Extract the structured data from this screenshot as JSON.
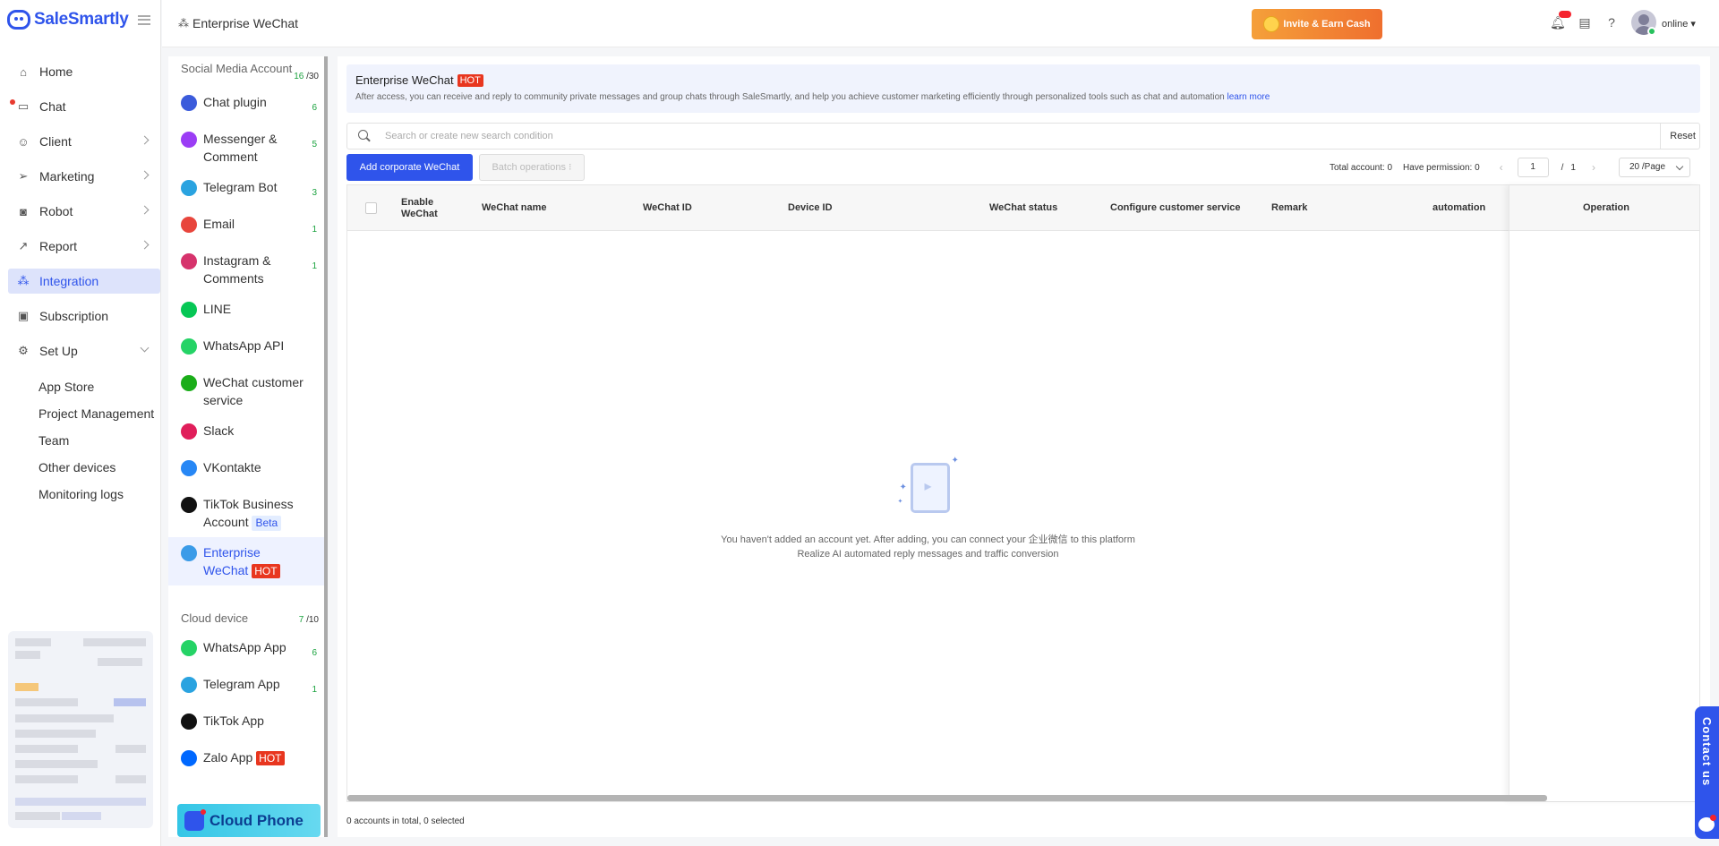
{
  "brand": {
    "name": "SaleSmartly"
  },
  "nav": {
    "items": [
      {
        "label": "Home",
        "icon": "home-icon"
      },
      {
        "label": "Chat",
        "icon": "chat-icon"
      },
      {
        "label": "Client",
        "icon": "client-icon"
      },
      {
        "label": "Marketing",
        "icon": "send-icon"
      },
      {
        "label": "Robot",
        "icon": "robot-icon"
      },
      {
        "label": "Report",
        "icon": "report-icon"
      },
      {
        "label": "Integration",
        "icon": "integration-icon",
        "active": true
      },
      {
        "label": "Subscription",
        "icon": "wallet-icon"
      },
      {
        "label": "Set Up",
        "icon": "settings-icon"
      }
    ],
    "setup_sub": [
      "App Store",
      "Project Management",
      "Team",
      "Other devices",
      "Monitoring logs"
    ]
  },
  "header": {
    "breadcrumb": "Enterprise WeChat",
    "invite_label": "Invite & Earn Cash",
    "status": "online"
  },
  "channels": {
    "social_group": {
      "title": "Social Media Account",
      "used": "16",
      "total": "/30"
    },
    "social": [
      {
        "name": "Chat plugin",
        "count": "6",
        "color": "#3b5bdb"
      },
      {
        "name": "Messenger & Comment",
        "count": "5",
        "color": "#9b3df5"
      },
      {
        "name": "Telegram Bot",
        "count": "3",
        "color": "#2aa3e0"
      },
      {
        "name": "Email",
        "count": "1",
        "color": "#e8453c"
      },
      {
        "name": "Instagram & Comments",
        "count": "1",
        "color": "#d6336c"
      },
      {
        "name": "LINE",
        "count": "",
        "color": "#06c755"
      },
      {
        "name": "WhatsApp API",
        "count": "",
        "color": "#25d366"
      },
      {
        "name": "WeChat customer service",
        "count": "",
        "color": "#1aad19"
      },
      {
        "name": "Slack",
        "count": "",
        "color": "#e01e5a"
      },
      {
        "name": "VKontakte",
        "count": "",
        "color": "#2787f5"
      },
      {
        "name": "TikTok Business Account",
        "count": "",
        "color": "#111111",
        "tag": "Beta"
      },
      {
        "name": "Enterprise WeChat",
        "count": "",
        "color": "#3a9be8",
        "tag": "HOT",
        "active": true
      }
    ],
    "cloud_group": {
      "title": "Cloud device",
      "used": "7",
      "total": "/10"
    },
    "cloud": [
      {
        "name": "WhatsApp App",
        "count": "6",
        "color": "#25d366"
      },
      {
        "name": "Telegram App",
        "count": "1",
        "color": "#2aa3e0"
      },
      {
        "name": "TikTok App",
        "count": "",
        "color": "#111111"
      },
      {
        "name": "Zalo App",
        "count": "",
        "color": "#0068ff",
        "tag": "HOT"
      }
    ],
    "banner": "Cloud Phone"
  },
  "main": {
    "intro_title": "Enterprise WeChat",
    "intro_tag": "HOT",
    "intro_desc": "After access, you can receive and reply to community private messages and group chats through SaleSmartly, and help you achieve customer marketing efficiently through personalized tools such as chat and automation",
    "learn_more": "learn more",
    "search_placeholder": "Search or create new search condition",
    "reset": "Reset",
    "add_button": "Add corporate WeChat",
    "batch_button": "Batch operations",
    "total_label": "Total account: 0",
    "permission_label": "Have permission: 0",
    "page_current": "1",
    "page_total": "1",
    "page_size": "20 /Page",
    "columns": [
      "Enable WeChat",
      "WeChat name",
      "WeChat ID",
      "Device ID",
      "WeChat status",
      "Configure customer service",
      "Remark",
      "automation",
      "Operation"
    ],
    "empty_line1": "You haven't added an account yet. After adding, you can connect your 企业微信 to this platform",
    "empty_line2": "Realize AI automated reply messages and traffic conversion",
    "footer": "0 accounts in total, 0 selected"
  },
  "contact": {
    "label": "Contact us"
  },
  "colors": {
    "accent": "#2f54eb",
    "hot": "#e8361f",
    "count": "#1aa23e"
  }
}
